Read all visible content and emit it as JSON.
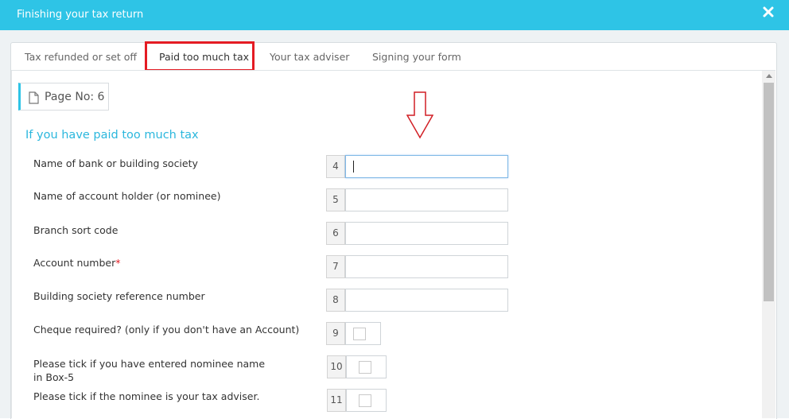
{
  "window": {
    "title": "Finishing your tax return",
    "close_icon": "close-icon"
  },
  "tabs": [
    {
      "label": "Tax refunded or set off",
      "active": false
    },
    {
      "label": "Paid too much tax",
      "active": true
    },
    {
      "label": "Your tax adviser",
      "active": false
    },
    {
      "label": "Signing your form",
      "active": false
    }
  ],
  "page": {
    "label": "Page No: 6",
    "icon": "document-icon"
  },
  "section": {
    "title": "If you have paid too much tax"
  },
  "fields": [
    {
      "box": "4",
      "label": "Name of bank or building society",
      "value": "",
      "focused": true
    },
    {
      "box": "5",
      "label": "Name of account holder (or nominee)",
      "value": ""
    },
    {
      "box": "6",
      "label": "Branch sort code",
      "value": ""
    },
    {
      "box": "7",
      "label": "Account number",
      "required_mark": "*",
      "value": ""
    },
    {
      "box": "8",
      "label": "Building society reference number",
      "value": ""
    }
  ],
  "checks": [
    {
      "box": "9",
      "label": "Cheque required? (only if you don't have an Account)",
      "checked": false
    },
    {
      "box": "10",
      "label_line1": "Please tick if you have entered nominee name",
      "label_line2": "in Box-5",
      "checked": false
    },
    {
      "box": "11",
      "label": "Please tick if the nominee is your tax adviser.",
      "checked": false
    }
  ],
  "colors": {
    "header": "#2ec4e6",
    "accent": "#2bb7dd",
    "highlight": "#e41b23"
  }
}
